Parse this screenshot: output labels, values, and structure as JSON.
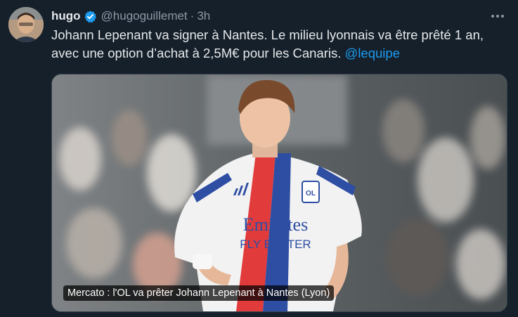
{
  "tweet": {
    "display_name": "hugo",
    "handle": "@hugoguillemet",
    "separator": "·",
    "time": "3h",
    "text_line1": "Johann Lepenant va signer à Nantes. Le milieu lyonnais va être prêté 1 an,",
    "text_line2": "avec une option d’achat à 2,5M€ pour les Canaris. ",
    "mention": "@lequipe"
  },
  "media": {
    "caption": "Mercato : l'OL va prêter Johann Lepenant à Nantes (Lyon)",
    "shirt_sponsor_line1": "Emirates",
    "shirt_sponsor_line2": "FLY BETTER"
  },
  "colors": {
    "background": "#15202b",
    "accent": "#1d9bf0",
    "secondary_text": "#8b98a5"
  },
  "icons": {
    "verified": "verified-badge-icon",
    "more": "more-options-icon"
  }
}
